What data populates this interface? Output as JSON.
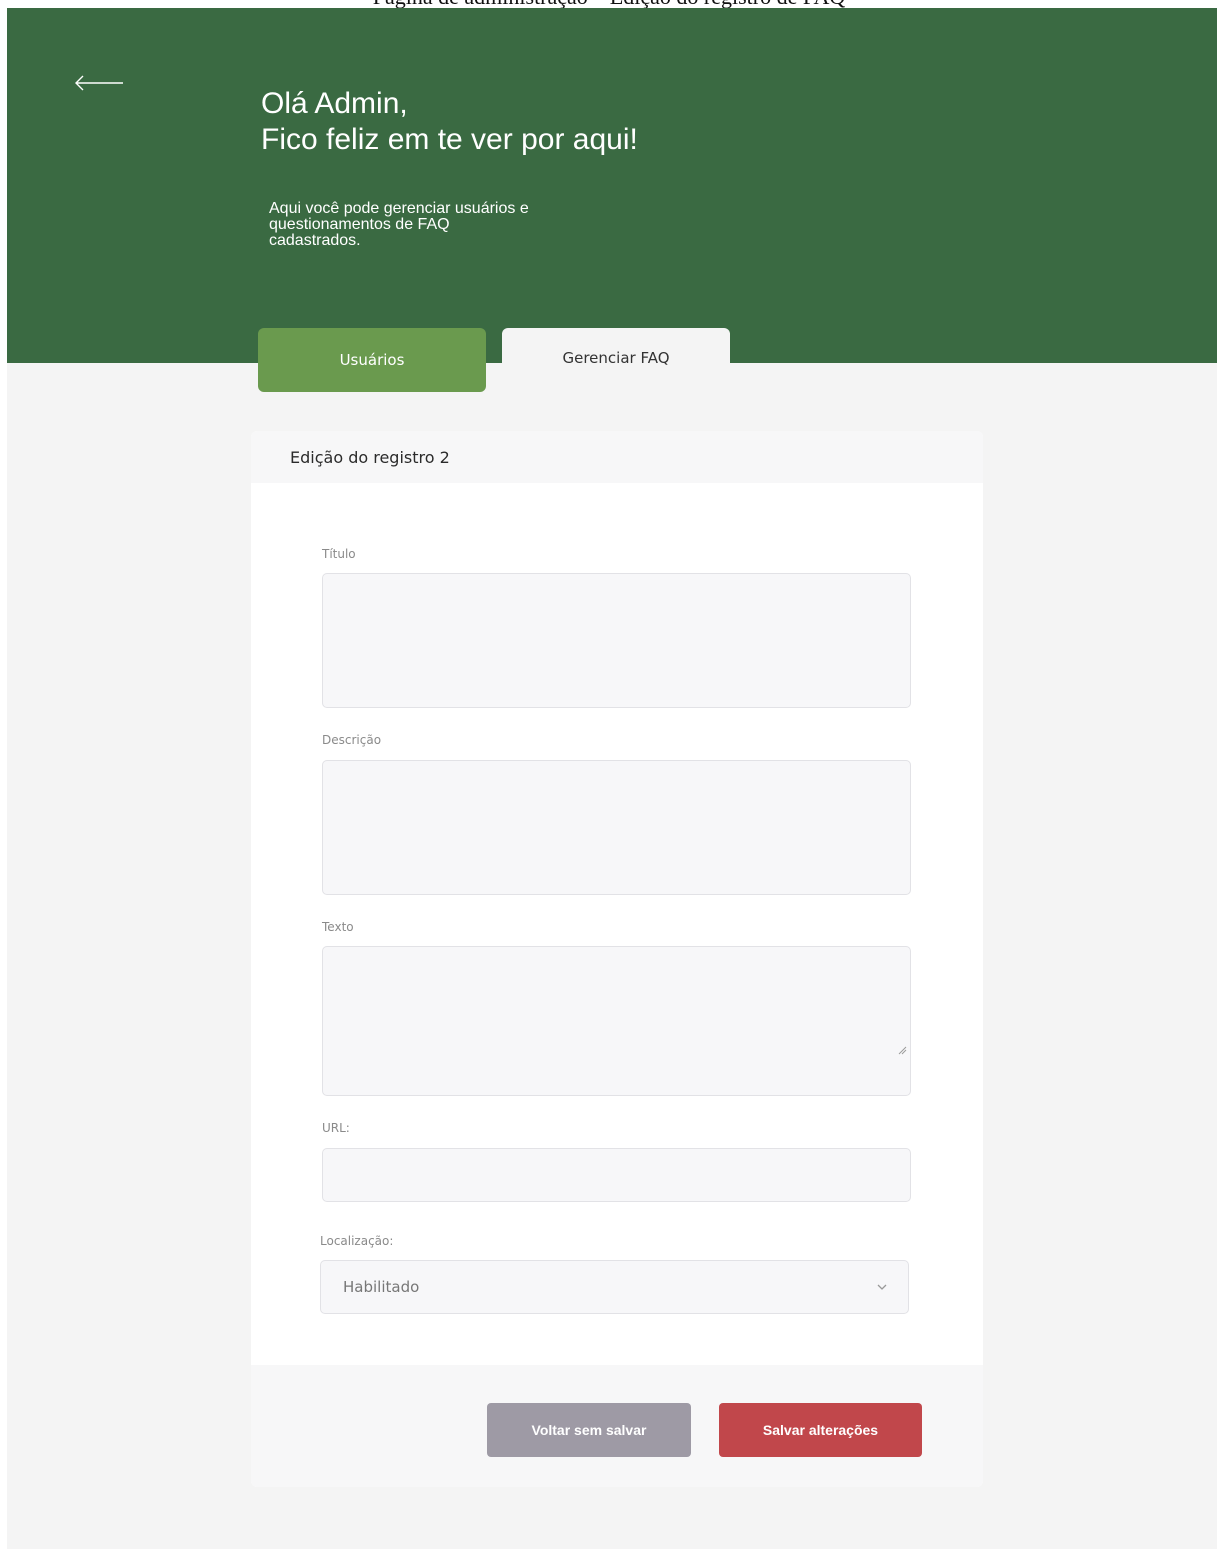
{
  "top_caption": "Página de administração – Edição do registro de FAQ",
  "hero": {
    "greeting_line1": "Olá Admin,",
    "greeting_line2": "Fico feliz em te ver por aqui!",
    "intro_line1": "Aqui você pode gerenciar usuários e",
    "intro_line2": "questionamentos de FAQ",
    "intro_line3": "cadastrados."
  },
  "tabs": [
    {
      "label": "Usuários"
    },
    {
      "label": "Gerenciar FAQ"
    }
  ],
  "form": {
    "title": "Edição do registro  2",
    "fields": {
      "titulo": {
        "label": "Título",
        "value": ""
      },
      "descricao": {
        "label": "Descrição",
        "value": ""
      },
      "texto": {
        "label": "Texto",
        "value": ""
      },
      "url": {
        "label": "URL:",
        "value": ""
      },
      "localizacao": {
        "label": "Localização:",
        "selected": "Habilitado"
      }
    }
  },
  "buttons": {
    "back_label": "Voltar sem salvar",
    "save_label": "Salvar alterações"
  },
  "colors": {
    "hero_bg": "#3a6a42",
    "tab_active": "#6a9a4e",
    "save_button": "#c1474b",
    "back_button": "#9e9aa5",
    "page_bg": "#f4f4f4"
  },
  "icons": {
    "back": "arrow-left-icon",
    "select": "chevron-down-icon",
    "resize": "resize-handle-icon"
  }
}
